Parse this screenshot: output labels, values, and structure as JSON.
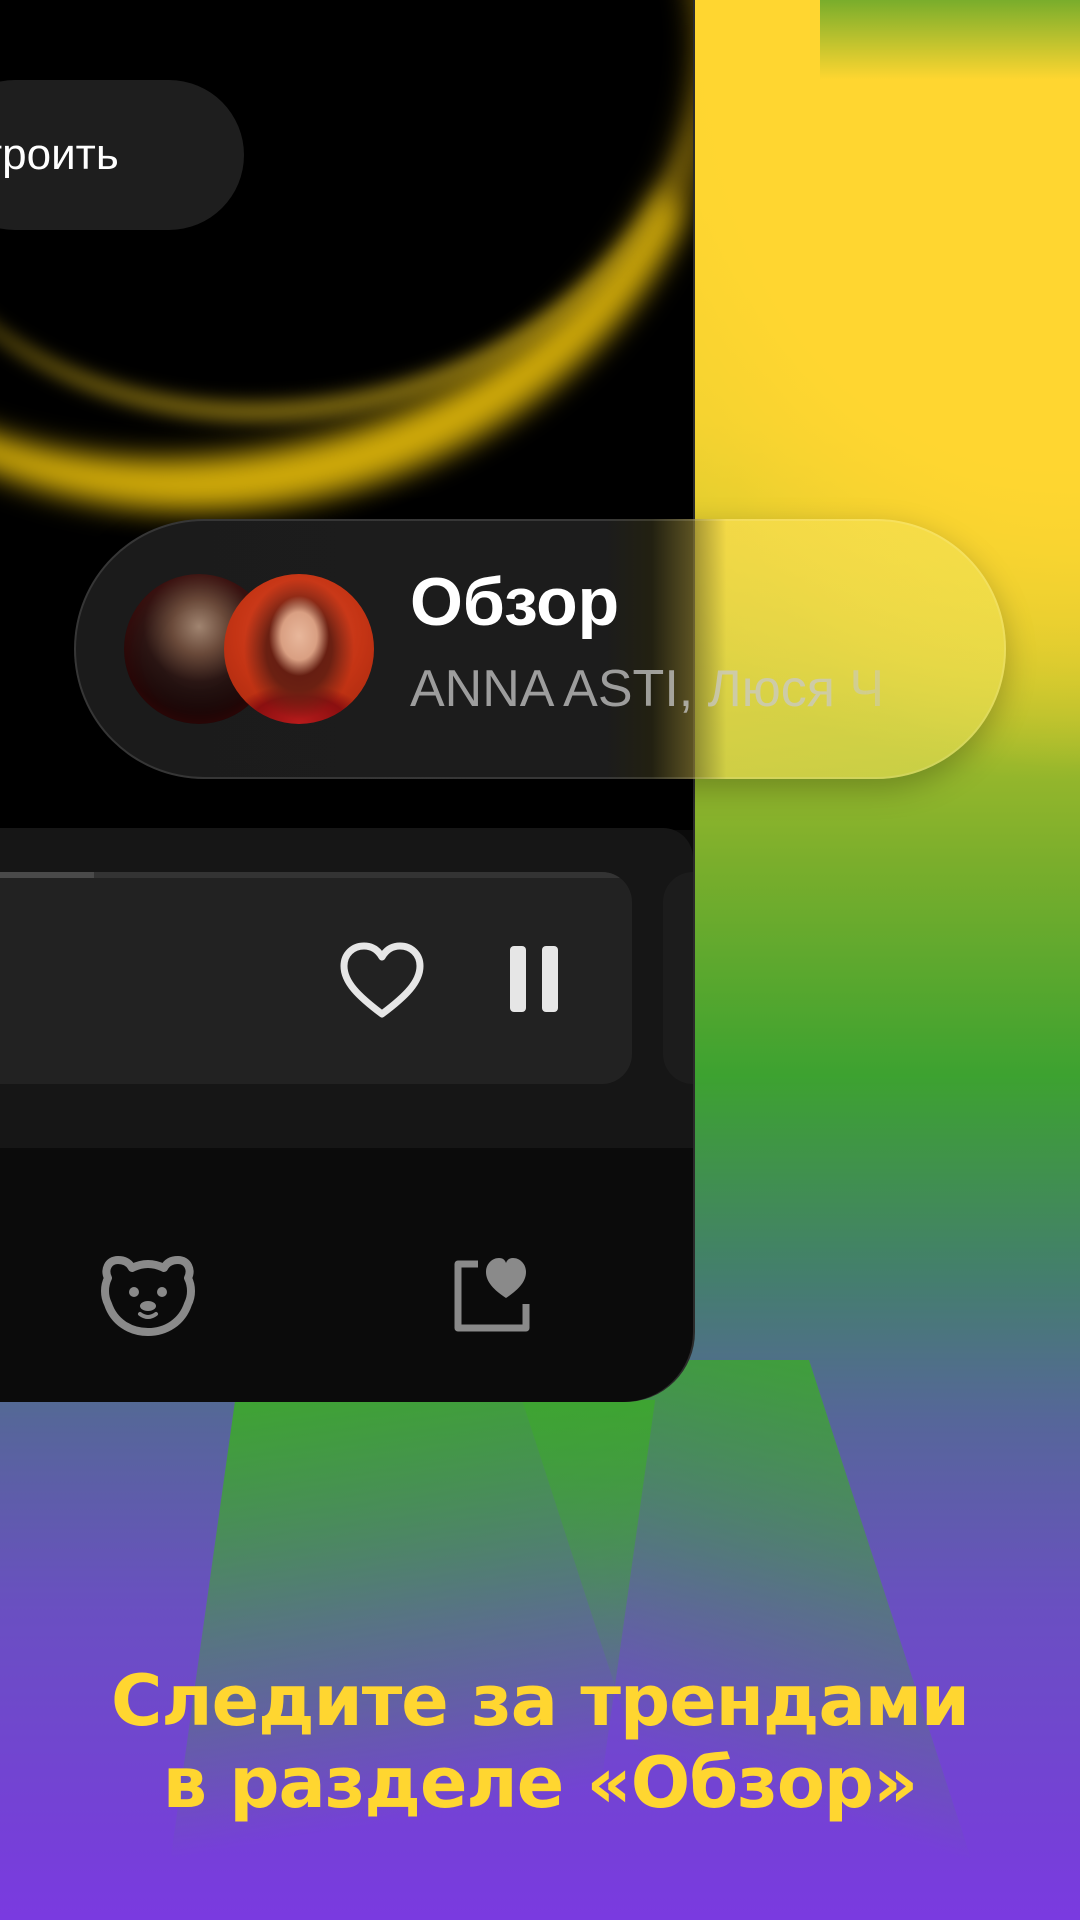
{
  "setup_button": {
    "label": "троить"
  },
  "now_playing_pill": {
    "title": "Обзор",
    "subtitle": "ANNA ASTI, Люся Ч",
    "avatars": [
      "artist-avatar",
      "artist-avatar"
    ]
  },
  "player": {
    "progress": 0.2,
    "like_icon": "heart-outline-icon",
    "pause_icon": "pause-icon"
  },
  "bottom_nav": {
    "items": [
      {
        "icon": "bear-icon"
      },
      {
        "icon": "collection-heart-icon"
      }
    ]
  },
  "promo": {
    "headline_line1": "Следите за трендами",
    "headline_line2": "в разделе «Обзор»"
  },
  "colors": {
    "accent": "#ffd630",
    "phone_bg": "#0b0b0b",
    "card_bg": "#222222"
  }
}
